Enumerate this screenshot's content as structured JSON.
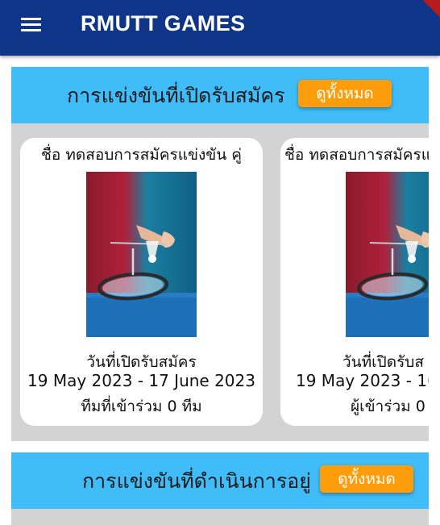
{
  "appbar": {
    "title": "RMUTT GAMES"
  },
  "open_section": {
    "title": "การแข่งขันที่เปิดรับสมัคร",
    "see_all": "ดูทั้งหมด",
    "cards": [
      {
        "name": "ชื่อ ทดสอบการสมัครแข่งขัน คู่",
        "date_label": "วันที่เปิดรับสมัคร",
        "date_range": "19 May 2023 - 17 June 2023",
        "participants": "ทีมที่เข้าร่วม 0 ทีม"
      },
      {
        "name": "ชื่อ ทดสอบการสมัครแ",
        "date_label": "วันที่เปิดรับส",
        "date_range": "19 May 2023 - 16",
        "participants": "ผู้เข้าร่วม 0"
      }
    ]
  },
  "ongoing_section": {
    "title": "การแข่งขันที่ดำเนินการอยู่",
    "see_all": "ดูทั้งหมด"
  },
  "colors": {
    "appbar": "#0f3588",
    "section_header": "#40bdf9",
    "see_all_button": "#fd9d0b",
    "carousel_bg": "#d3d3d3"
  },
  "icons": {
    "menu": "hamburger-menu-icon"
  }
}
